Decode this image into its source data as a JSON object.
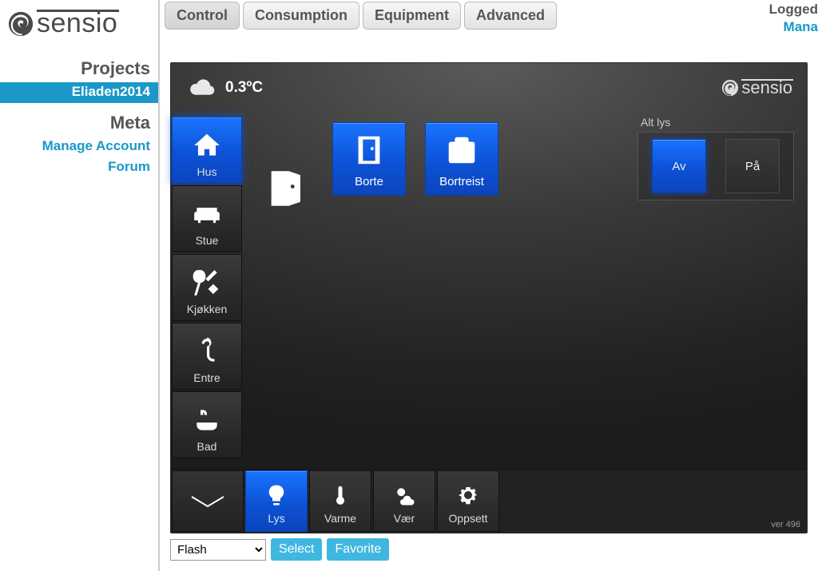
{
  "brand": "sensio",
  "top_tabs": {
    "control": "Control",
    "consumption": "Consumption",
    "equipment": "Equipment",
    "advanced": "Advanced"
  },
  "top_right": {
    "logged": "Logged",
    "manage": "Mana"
  },
  "sidebar": {
    "projects_header": "Projects",
    "project_active": "Eliaden2014",
    "meta_header": "Meta",
    "manage_account": "Manage Account",
    "forum": "Forum"
  },
  "weather": {
    "temp": "0.3ºC"
  },
  "rooms": [
    {
      "id": "hus",
      "label": "Hus",
      "active": true
    },
    {
      "id": "stue",
      "label": "Stue"
    },
    {
      "id": "kjokken",
      "label": "Kjøkken"
    },
    {
      "id": "entre",
      "label": "Entre"
    },
    {
      "id": "bad",
      "label": "Bad"
    }
  ],
  "scenes": {
    "borte": "Borte",
    "bortreist": "Bortreist"
  },
  "alt_lys": {
    "label": "Alt lys",
    "off": "Av",
    "on": "På"
  },
  "categories": {
    "lys": "Lys",
    "varme": "Varme",
    "vaer": "Vær",
    "oppsett": "Oppsett"
  },
  "version": "ver 496",
  "below": {
    "viewer_option": "Flash",
    "select_btn": "Select",
    "favorite_btn": "Favorite"
  }
}
